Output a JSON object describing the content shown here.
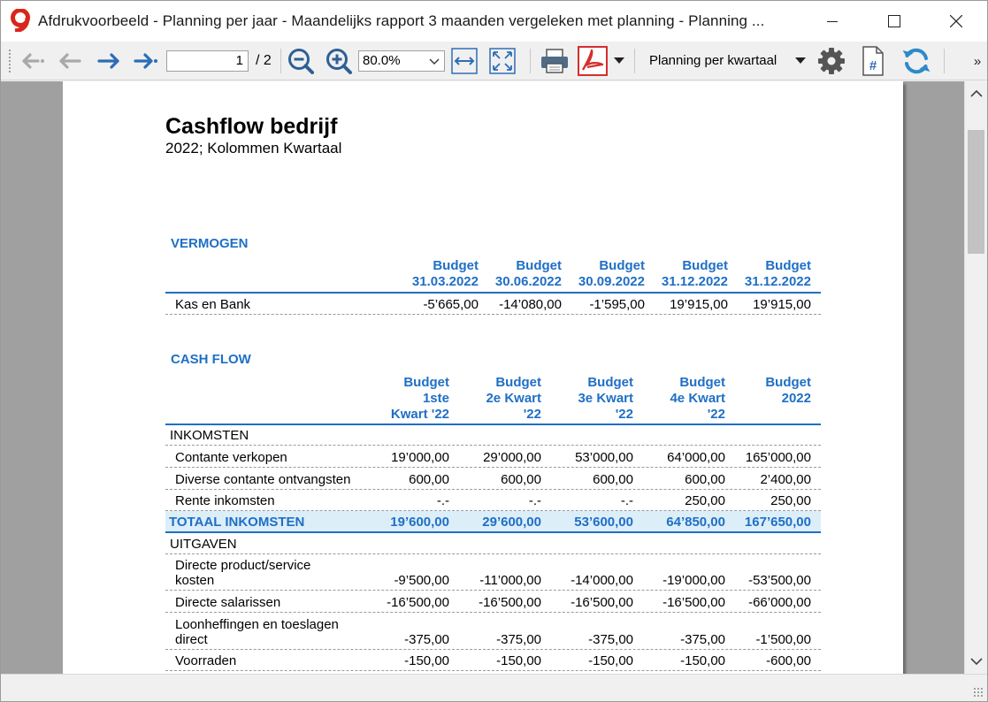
{
  "window": {
    "title": "Afdrukvoorbeeld - Planning per jaar - Maandelijks rapport 3 maanden vergeleken met planning - Planning ..."
  },
  "toolbar": {
    "page_current": "1",
    "page_total": "/ 2",
    "zoom_value": "80.0%",
    "planning_select": "Planning per kwartaal",
    "overflow": "»"
  },
  "colors": {
    "accent": "#1f6fc5",
    "total_row_bg": "#dceef8",
    "pdf_red": "#d32f2f",
    "nav_blue": "#2d6db5",
    "app_icon_red": "#d9261c"
  },
  "report": {
    "title": "Cashflow bedrijf",
    "subtitle": "2022; Kolommen Kwartaal",
    "vermogen": {
      "section_title": "VERMOGEN",
      "columns": [
        {
          "line1": "Budget",
          "line2": "31.03.2022"
        },
        {
          "line1": "Budget",
          "line2": "30.06.2022"
        },
        {
          "line1": "Budget",
          "line2": "30.09.2022"
        },
        {
          "line1": "Budget",
          "line2": "31.12.2022"
        },
        {
          "line1": "Budget",
          "line2": "31.12.2022"
        }
      ],
      "rows": [
        {
          "label": "Kas en Bank",
          "values": [
            "-5’665,00",
            "-14’080,00",
            "-1’595,00",
            "19’915,00",
            "19’915,00"
          ]
        }
      ]
    },
    "cashflow": {
      "section_title": "CASH FLOW",
      "columns": [
        {
          "line1": "Budget",
          "line2": "1ste",
          "line3": "Kwart '22"
        },
        {
          "line1": "Budget",
          "line2": "2e Kwart",
          "line3": "'22"
        },
        {
          "line1": "Budget",
          "line2": "3e Kwart",
          "line3": "'22"
        },
        {
          "line1": "Budget",
          "line2": "4e Kwart",
          "line3": "'22"
        },
        {
          "line1": "Budget",
          "line2": "2022",
          "line3": ""
        }
      ],
      "inkomsten_label": "INKOMSTEN",
      "inkomsten_rows": [
        {
          "label": "Contante verkopen",
          "values": [
            "19’000,00",
            "29’000,00",
            "53’000,00",
            "64’000,00",
            "165’000,00"
          ]
        },
        {
          "label": "Diverse contante ontvangsten",
          "values": [
            "600,00",
            "600,00",
            "600,00",
            "600,00",
            "2’400,00"
          ]
        },
        {
          "label": "Rente inkomsten",
          "values": [
            "-.-",
            "-.-",
            "-.-",
            "250,00",
            "250,00"
          ]
        }
      ],
      "totaal_inkomsten": {
        "label": "TOTAAL INKOMSTEN",
        "values": [
          "19’600,00",
          "29’600,00",
          "53’600,00",
          "64’850,00",
          "167’650,00"
        ]
      },
      "uitgaven_label": "UITGAVEN",
      "uitgaven_rows": [
        {
          "label_line1": "Directe product/service",
          "label_line2": "kosten",
          "values": [
            "-9’500,00",
            "-11’000,00",
            "-14’000,00",
            "-19’000,00",
            "-53’500,00"
          ]
        },
        {
          "label_line1": "Directe salarissen",
          "label_line2": "",
          "values": [
            "-16’500,00",
            "-16’500,00",
            "-16’500,00",
            "-16’500,00",
            "-66’000,00"
          ]
        },
        {
          "label_line1": "Loonheffingen en toeslagen",
          "label_line2": "direct",
          "values": [
            "-375,00",
            "-375,00",
            "-375,00",
            "-375,00",
            "-1’500,00"
          ]
        },
        {
          "label_line1": "Voorraden",
          "label_line2": "",
          "values": [
            "-150,00",
            "-150,00",
            "-150,00",
            "-150,00",
            "-600,00"
          ]
        }
      ]
    }
  }
}
